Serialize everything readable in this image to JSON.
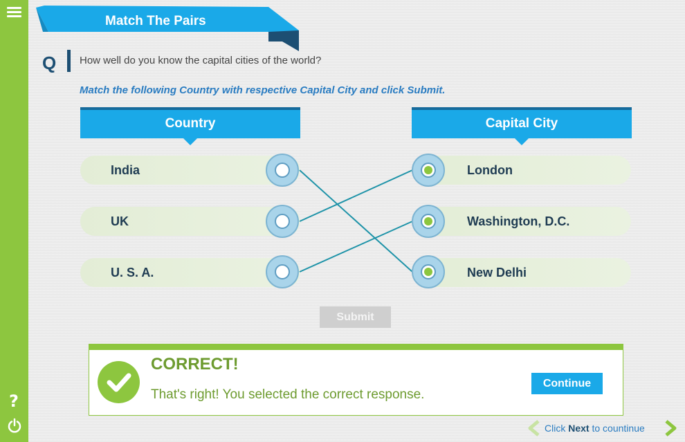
{
  "title": "Match The Pairs",
  "question": {
    "letter": "Q",
    "text": "How well do you know the capital cities of the world?",
    "instruction": "Match the following Country with respective Capital City and click Submit."
  },
  "columns": {
    "left_header": "Country",
    "right_header": "Capital City"
  },
  "left_items": [
    {
      "label": "India"
    },
    {
      "label": "UK"
    },
    {
      "label": "U. S. A."
    }
  ],
  "right_items": [
    {
      "label": "London",
      "selected": true
    },
    {
      "label": "Washington, D.C.",
      "selected": true
    },
    {
      "label": "New Delhi",
      "selected": true
    }
  ],
  "matches": [
    {
      "from": "India",
      "to": "New Delhi"
    },
    {
      "from": "UK",
      "to": "London"
    },
    {
      "from": "U. S. A.",
      "to": "Washington, D.C."
    }
  ],
  "submit_label": "Submit",
  "feedback": {
    "title": "CORRECT!",
    "message": "That's right!  You selected the correct response.",
    "continue_label": "Continue"
  },
  "footer": {
    "prefix": "Click",
    "bold": "Next",
    "suffix": "to countinue"
  },
  "sidebar": {
    "help": "?"
  },
  "colors": {
    "sidebar_green": "#8dc63f",
    "header_blue": "#1aa9e8",
    "line_teal": "#1e93a8"
  }
}
